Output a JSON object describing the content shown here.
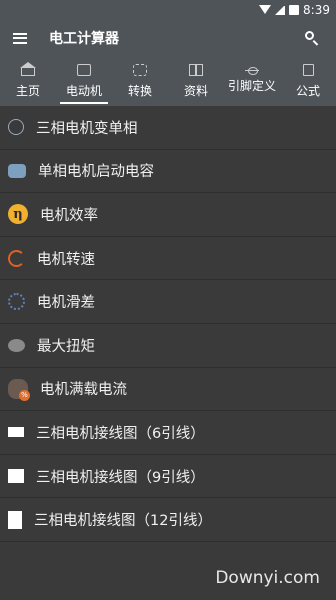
{
  "status": {
    "time": "8:39"
  },
  "app": {
    "title": "电工计算器"
  },
  "tabs": [
    {
      "label": "主页",
      "icon": "home-icon",
      "active": false
    },
    {
      "label": "电动机",
      "icon": "motor-icon",
      "active": true
    },
    {
      "label": "转换",
      "icon": "convert-icon",
      "active": false
    },
    {
      "label": "资料",
      "icon": "book-icon",
      "active": false
    },
    {
      "label": "引脚定义",
      "icon": "pin-icon",
      "active": false
    },
    {
      "label": "公式",
      "icon": "formula-icon",
      "active": false
    }
  ],
  "items": [
    {
      "label": "三相电机变单相",
      "icon": "three-to-single-phase-icon"
    },
    {
      "label": "单相电机启动电容",
      "icon": "capacitor-icon"
    },
    {
      "label": "电机效率",
      "icon": "efficiency-eta-icon",
      "glyph": "η"
    },
    {
      "label": "电机转速",
      "icon": "speed-icon"
    },
    {
      "label": "电机滑差",
      "icon": "slip-icon"
    },
    {
      "label": "最大扭矩",
      "icon": "torque-icon"
    },
    {
      "label": "电机满载电流",
      "icon": "full-load-current-icon"
    },
    {
      "label": "三相电机接线图（6引线）",
      "icon": "wiring-6-lead-icon"
    },
    {
      "label": "三相电机接线图（9引线）",
      "icon": "wiring-9-lead-icon"
    },
    {
      "label": "三相电机接线图（12引线）",
      "icon": "wiring-12-lead-icon"
    }
  ],
  "watermark": "Downyi.com",
  "colors": {
    "appbar": "#4e5458",
    "background": "#3a3a3a"
  }
}
